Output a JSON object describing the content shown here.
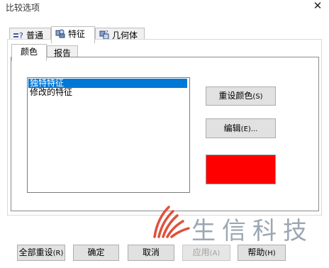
{
  "window": {
    "title": "比较选项"
  },
  "top_tabs": [
    {
      "icon": "equals-question-icon",
      "label": "普通"
    },
    {
      "icon": "features-icon",
      "label": "特征"
    },
    {
      "icon": "geometry-icon",
      "label": "几何体"
    }
  ],
  "sub_tabs": [
    {
      "label": "颜色"
    },
    {
      "label": "报告"
    }
  ],
  "list": {
    "items": [
      {
        "label": "独特特征",
        "selected": true
      },
      {
        "label": "修改的特征",
        "selected": false
      }
    ]
  },
  "side_buttons": {
    "reset_colors": {
      "label": "重设颜色",
      "mnemonic": "(S)"
    },
    "edit": {
      "label": "编辑",
      "mnemonic": "(E)..."
    }
  },
  "swatch": {
    "color": "#ff0000"
  },
  "watermark": {
    "text": "生信科技",
    "logo_color": "#e0503c"
  },
  "footer_buttons": [
    {
      "label": "全部重设",
      "mnemonic": "(R)",
      "enabled": true
    },
    {
      "label": "确定",
      "mnemonic": "",
      "enabled": true
    },
    {
      "label": "取消",
      "mnemonic": "",
      "enabled": true
    },
    {
      "label": "应用",
      "mnemonic": "(A)",
      "enabled": false
    },
    {
      "label": "帮助",
      "mnemonic": "(H)",
      "enabled": true
    }
  ],
  "colors": {
    "selection": "#0078d7",
    "button_bg": "#e1e1e1"
  }
}
